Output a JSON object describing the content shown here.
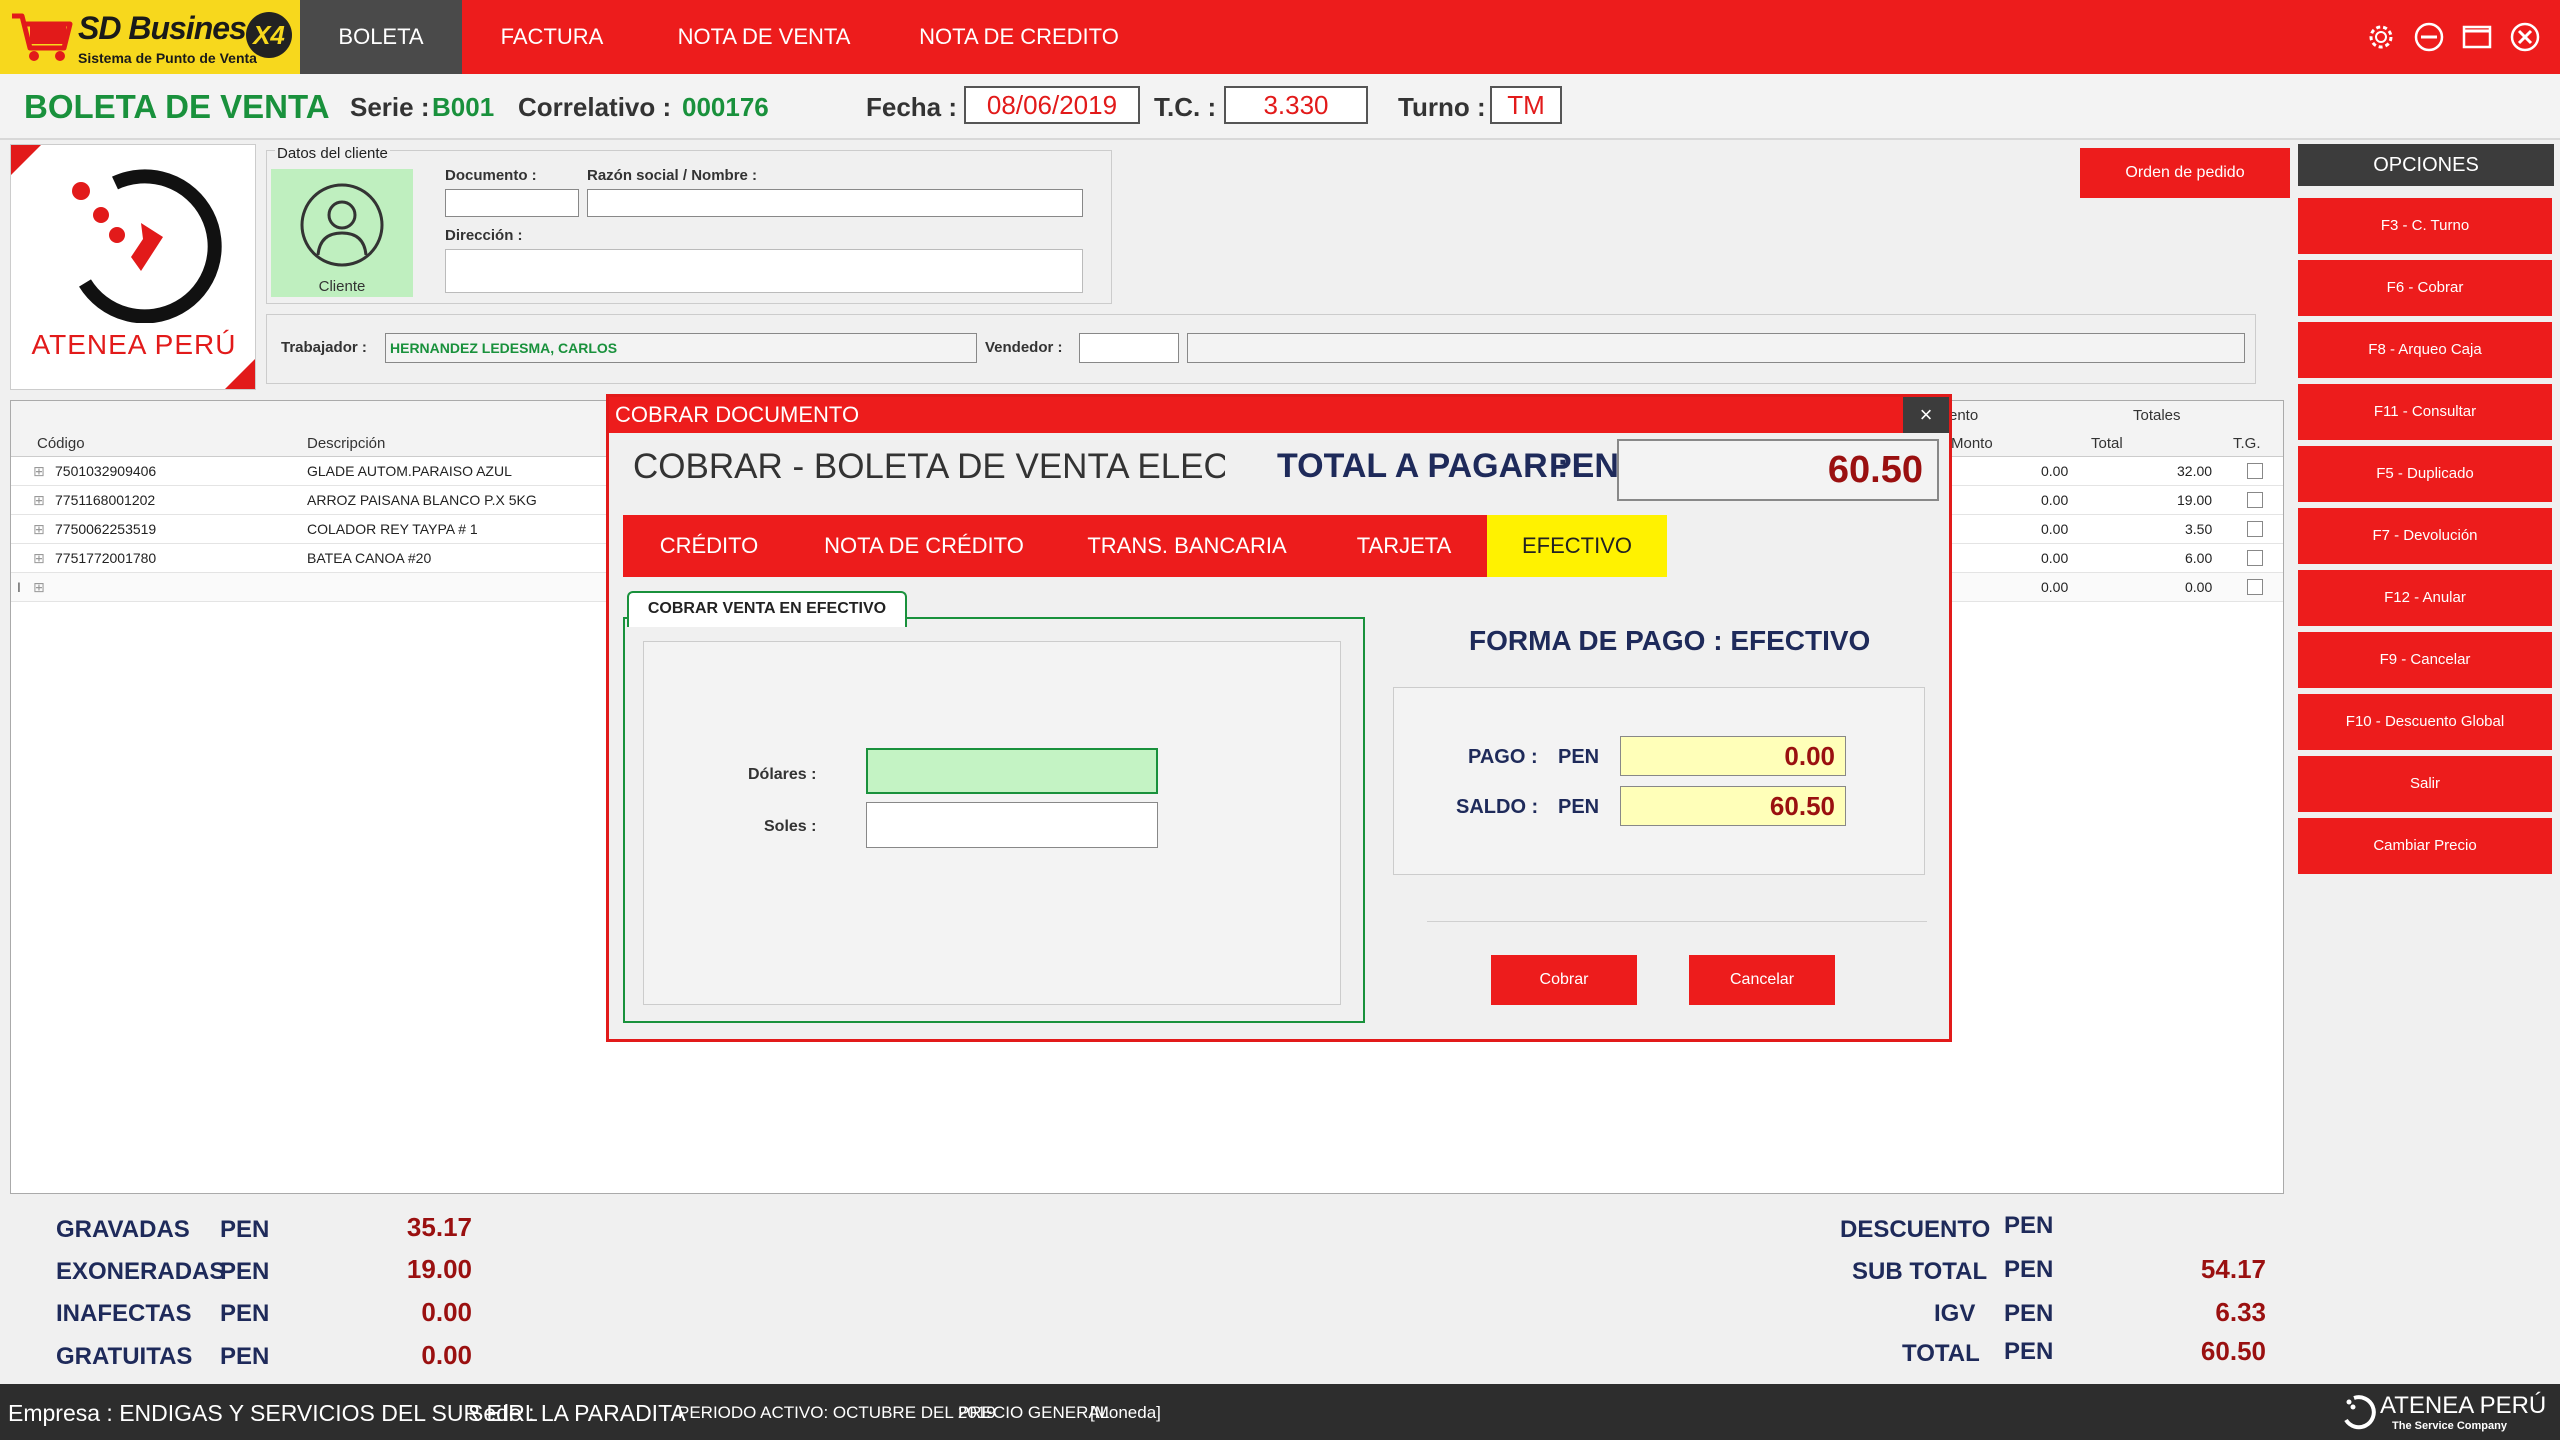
{
  "app": {
    "name": "SD Business",
    "tagline": "Sistema de Punto de Venta",
    "version_badge": "X4"
  },
  "nav": {
    "tabs": [
      {
        "label": "BOLETA",
        "active": true
      },
      {
        "label": "FACTURA",
        "active": false
      },
      {
        "label": "NOTA DE VENTA",
        "active": false
      },
      {
        "label": "NOTA DE CREDITO",
        "active": false
      }
    ]
  },
  "window_controls": [
    "gear-icon",
    "minimize-icon",
    "maximize-icon",
    "close-icon"
  ],
  "header": {
    "title": "BOLETA DE VENTA",
    "serie_label": "Serie :",
    "serie_value": "B001",
    "correlativo_label": "Correlativo :",
    "correlativo_value": "000176",
    "fecha_label": "Fecha :",
    "fecha_value": "08/06/2019",
    "tc_label": "T.C. :",
    "tc_value": "3.330",
    "turno_label": "Turno :",
    "turno_value": "TM"
  },
  "brand": {
    "name": "ATENEA PERÚ"
  },
  "client": {
    "group_label": "Datos del cliente",
    "avatar_caption": "Cliente",
    "documento_label": "Documento :",
    "documento_value": "",
    "razon_label": "Razón social / Nombre :",
    "razon_value": "",
    "direccion_label": "Dirección :",
    "direccion_value": ""
  },
  "worker": {
    "trabajador_label": "Trabajador :",
    "trabajador_value": "HERNANDEZ LEDESMA, CARLOS",
    "vendedor_label": "Vendedor :",
    "vendedor_value": ""
  },
  "order_button": "Orden de pedido",
  "options": {
    "title": "OPCIONES",
    "buttons": [
      "F3 - C. Turno",
      "F6 - Cobrar",
      "F8 - Arqueo Caja",
      "F11 - Consultar",
      "F5 - Duplicado",
      "F7 - Devolución",
      "F12 - Anular",
      "F9 - Cancelar",
      "F10 - Descuento Global",
      "Salir",
      "Cambiar Precio"
    ]
  },
  "grid": {
    "group_headers": {
      "descuento_partial": "ento",
      "totales": "Totales"
    },
    "columns": {
      "codigo": "Código",
      "descripcion": "Descripción",
      "monto": "Monto",
      "total": "Total",
      "tg": "T.G."
    },
    "rows": [
      {
        "codigo": "7501032909406",
        "descripcion": "GLADE AUTOM.PARAISO AZUL",
        "monto": "0.00",
        "total": "32.00"
      },
      {
        "codigo": "7751168001202",
        "descripcion": "ARROZ PAISANA BLANCO P.X 5KG",
        "monto": "0.00",
        "total": "19.00"
      },
      {
        "codigo": "7750062253519",
        "descripcion": "COLADOR REY TAYPA # 1",
        "monto": "0.00",
        "total": "3.50"
      },
      {
        "codigo": "7751772001780",
        "descripcion": "BATEA CANOA #20",
        "monto": "0.00",
        "total": "6.00"
      },
      {
        "codigo": "",
        "descripcion": "",
        "monto": "0.00",
        "total": "0.00"
      }
    ]
  },
  "totals_left": [
    {
      "label": "GRAVADAS",
      "currency": "PEN",
      "value": "35.17"
    },
    {
      "label": "EXONERADAS",
      "currency": "PEN",
      "value": "19.00"
    },
    {
      "label": "INAFECTAS",
      "currency": "PEN",
      "value": "0.00"
    },
    {
      "label": "GRATUITAS",
      "currency": "PEN",
      "value": "0.00"
    }
  ],
  "totals_right": [
    {
      "label": "DESCUENTO",
      "currency": "PEN",
      "value": ""
    },
    {
      "label": "SUB TOTAL",
      "currency": "PEN",
      "value": "54.17"
    },
    {
      "label": "IGV",
      "currency": "PEN",
      "value": "6.33"
    },
    {
      "label": "TOTAL",
      "currency": "PEN",
      "value": "60.50"
    }
  ],
  "status": {
    "empresa": "Empresa : ENDIGAS Y SERVICIOS DEL SUR EIRL",
    "sede": "Sede : LA PARADITA",
    "periodo": "PERIODO ACTIVO: OCTUBRE DEL 2019",
    "precio": "PRECIO GENERAL",
    "moneda": "[Moneda]",
    "footer_brand": "ATENEA PERÚ",
    "footer_tagline": "The Service Company"
  },
  "modal": {
    "title": "COBRAR DOCUMENTO",
    "close": "×",
    "heading": "COBRAR - BOLETA DE VENTA ELECTRON",
    "total_label": "TOTAL A PAGAR :",
    "total_currency": "PEN",
    "total_value": "60.50",
    "tabs": [
      {
        "label": "CRÉDITO",
        "active": false
      },
      {
        "label": "NOTA DE CRÉDITO",
        "active": false
      },
      {
        "label": "TRANS. BANCARIA",
        "active": false
      },
      {
        "label": "TARJETA",
        "active": false
      },
      {
        "label": "EFECTIVO",
        "active": true
      }
    ],
    "cash_tab": "COBRAR VENTA EN EFECTIVO",
    "dolares_label": "Dólares :",
    "dolares_value": "",
    "soles_label": "Soles :",
    "soles_value": "",
    "forma_pago": "FORMA DE PAGO : EFECTIVO",
    "pago_label": "PAGO :",
    "pago_currency": "PEN",
    "pago_value": "0.00",
    "saldo_label": "SALDO :",
    "saldo_currency": "PEN",
    "saldo_value": "60.50",
    "cobrar_button": "Cobrar",
    "cancelar_button": "Cancelar"
  }
}
